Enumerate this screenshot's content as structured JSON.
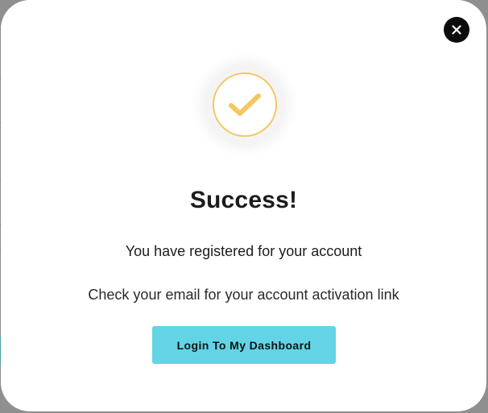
{
  "modal": {
    "title": "Success!",
    "subtitle": "You have registered for your account",
    "message": "Check your email for your account activation link",
    "primary_button_label": "Login To My Dashboard",
    "close_icon": "close-icon",
    "status_icon": "checkmark-icon"
  },
  "colors": {
    "accent_button": "#62d4e6",
    "check_color": "#f5c760",
    "close_bg": "#0c0c0c"
  }
}
